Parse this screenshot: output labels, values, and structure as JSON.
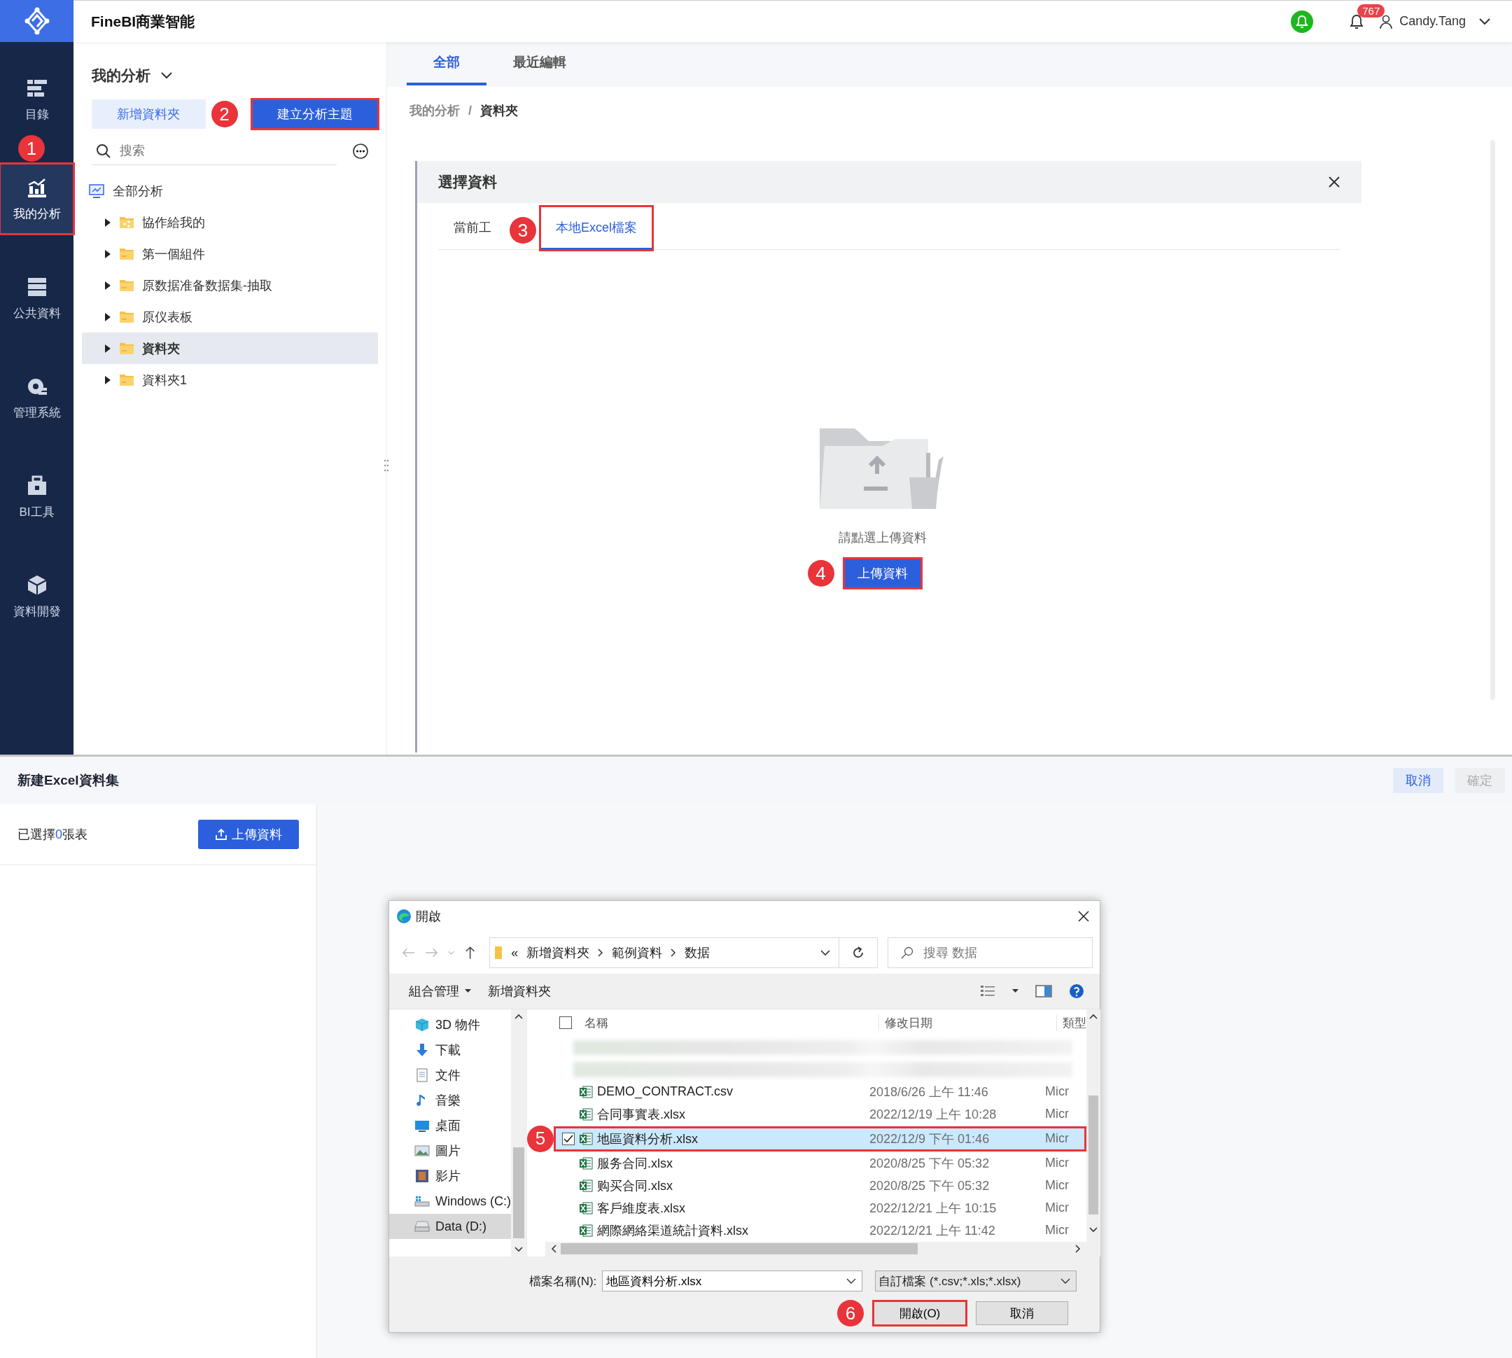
{
  "app": {
    "title": "FineBI商業智能"
  },
  "topbar": {
    "notification_count": "767",
    "user": "Candy.Tang"
  },
  "nav": [
    {
      "label": "目錄",
      "kind": "catalog",
      "selected": false,
      "highlighted": false
    },
    {
      "label": "我的分析",
      "kind": "analysis",
      "selected": true,
      "highlighted": true,
      "step": "1"
    },
    {
      "label": "公共資料",
      "kind": "public",
      "selected": false,
      "highlighted": false
    },
    {
      "label": "管理系統",
      "kind": "system",
      "selected": false,
      "highlighted": false
    },
    {
      "label": "BI工具",
      "kind": "tools",
      "selected": false,
      "highlighted": false
    },
    {
      "label": "資料開發",
      "kind": "dev",
      "selected": false,
      "highlighted": false
    }
  ],
  "panel": {
    "title": "我的分析",
    "new_folder_button": "新增資料夾",
    "create_button": {
      "label": "建立分析主題",
      "highlighted": true,
      "step": "2"
    },
    "search": {
      "placeholder": "搜索"
    },
    "tree": {
      "label": "全部分析",
      "children": [
        {
          "label": "協作給我的",
          "kind": "shared",
          "selected": false
        },
        {
          "label": "第一個組件",
          "kind": "folder",
          "selected": false
        },
        {
          "label": "原数据准备数据集-抽取",
          "kind": "folder",
          "selected": false
        },
        {
          "label": "原仪表板",
          "kind": "folder",
          "selected": false
        },
        {
          "label": "資料夾",
          "kind": "folder",
          "selected": true
        },
        {
          "label": "資料夾1",
          "kind": "folder",
          "selected": false
        }
      ]
    }
  },
  "main": {
    "tabs": [
      {
        "label": "全部",
        "selected": true
      },
      {
        "label": "最近編輯",
        "selected": false
      }
    ],
    "breadcrumb": [
      "我的分析",
      "資料夾"
    ],
    "breadcrumb_separator": "/",
    "select_panel": {
      "title": "選擇資料",
      "tabs": [
        {
          "label": "當前工",
          "selected": false,
          "highlighted": false
        },
        {
          "label": "本地Excel檔案",
          "selected": true,
          "highlighted": true,
          "step": "3"
        }
      ],
      "empty_hint": "請點選上傳資料",
      "upload_button": {
        "label": "上傳資料",
        "highlighted": true,
        "step": "4"
      }
    }
  },
  "dataset": {
    "title": "新建Excel資料集",
    "actions": [
      {
        "label": "取消",
        "disabled": false
      },
      {
        "label": "確定",
        "disabled": true
      }
    ],
    "selection": {
      "prefix": "已選擇",
      "count": "0",
      "suffix": "張表"
    },
    "upload_button": "上傳資料"
  },
  "dialog": {
    "title": "開啟",
    "path_prefix": "«",
    "path": [
      "新增資料夾",
      "範例資料",
      "数据"
    ],
    "search_placeholder": "搜尋 数据",
    "toolbar": [
      "組合管理",
      "新增資料夾"
    ],
    "nav": [
      {
        "label": "3D 物件",
        "kind": "objects",
        "selected": false
      },
      {
        "label": "下載",
        "kind": "download",
        "selected": false
      },
      {
        "label": "文件",
        "kind": "docs",
        "selected": false
      },
      {
        "label": "音樂",
        "kind": "music",
        "selected": false
      },
      {
        "label": "桌面",
        "kind": "desktop",
        "selected": false
      },
      {
        "label": "圖片",
        "kind": "pictures",
        "selected": false
      },
      {
        "label": "影片",
        "kind": "videos",
        "selected": false
      },
      {
        "label": "Windows (C:)",
        "kind": "drive_c",
        "selected": false
      },
      {
        "label": "Data (D:)",
        "kind": "drive_d",
        "selected": true
      }
    ],
    "columns": [
      "名稱",
      "修改日期",
      "類型"
    ],
    "select_all_checked": false,
    "rows": [
      {
        "name": "DEMO_CONTRACT.csv",
        "date": "2018/6/26 上午 11:46",
        "type": "Micr",
        "selected": false
      },
      {
        "name": "合同事實表.xlsx",
        "date": "2022/12/19 上午 10:28",
        "type": "Micr",
        "selected": false
      },
      {
        "name": "地區資料分析.xlsx",
        "date": "2022/12/9 下午 01:46",
        "type": "Micr",
        "selected": true,
        "step": "5"
      },
      {
        "name": "服务合同.xlsx",
        "date": "2020/8/25 下午 05:32",
        "type": "Micr",
        "selected": false
      },
      {
        "name": "购买合同.xlsx",
        "date": "2020/8/25 下午 05:32",
        "type": "Micr",
        "selected": false
      },
      {
        "name": "客戶維度表.xlsx",
        "date": "2022/12/21 上午 10:15",
        "type": "Micr",
        "selected": false
      },
      {
        "name": "網際網絡渠道統計資料.xlsx",
        "date": "2022/12/21 上午 11:42",
        "type": "Micr",
        "selected": false
      }
    ],
    "filename": {
      "label": "檔案名稱(N):",
      "value": "地區資料分析.xlsx"
    },
    "filter": "自訂檔案 (*.csv;*.xls;*.xlsx)",
    "buttons": [
      {
        "label": "開啟(O)",
        "highlighted": true,
        "step": "6"
      },
      {
        "label": "取消",
        "highlighted": false
      }
    ]
  }
}
